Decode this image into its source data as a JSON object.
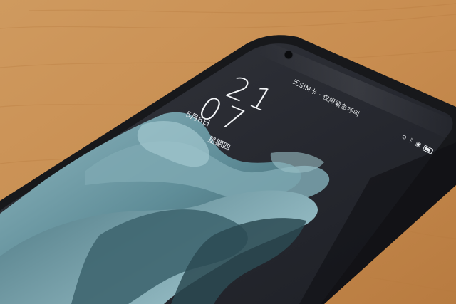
{
  "status_bar": {
    "carrier_text": "无SIM卡 · 仅限紧急呼叫",
    "icons": [
      "signal-off-icon",
      "bluetooth-icon",
      "nfc-icon",
      "battery-icon"
    ]
  },
  "lockscreen": {
    "clock_hour": "21",
    "clock_minute": "07",
    "date_month_day": "5月6日",
    "date_weekday": "星期四"
  },
  "colors": {
    "wood": "#c98f52",
    "phone_frame": "#1b1c1f",
    "screen_bg": "#2a2c34",
    "petal_teal": "#6f9ba6"
  }
}
